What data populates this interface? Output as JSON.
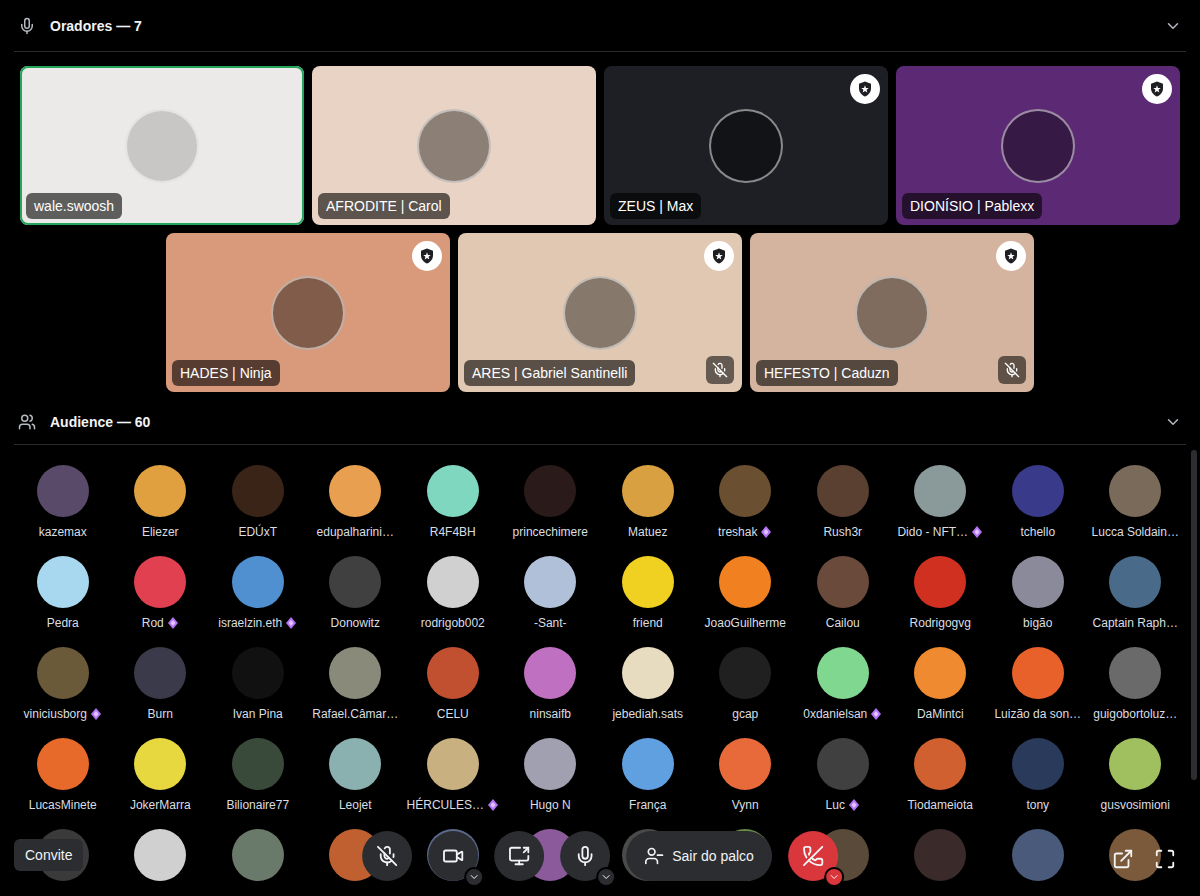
{
  "speakers": {
    "title": "Oradores — 7",
    "expanded": true,
    "items": [
      {
        "name": "wale.swoosh",
        "color": "#eceae8",
        "speaking": true,
        "moderator": false,
        "muted": false
      },
      {
        "name": "AFRODITE | Carol",
        "color": "#e8d3c4",
        "speaking": false,
        "moderator": false,
        "muted": false
      },
      {
        "name": "ZEUS | Max",
        "color": "#1d1f24",
        "speaking": false,
        "moderator": true,
        "muted": false
      },
      {
        "name": "DIONÍSIO | Pablexx",
        "color": "#5c2a74",
        "speaking": false,
        "moderator": true,
        "muted": false
      },
      {
        "name": "HADES | Ninja",
        "color": "#d99a7b",
        "speaking": false,
        "moderator": true,
        "muted": false
      },
      {
        "name": "ARES | Gabriel Santinelli",
        "color": "#e0c8b3",
        "speaking": false,
        "moderator": true,
        "muted": true
      },
      {
        "name": "HEFESTO | Caduzn",
        "color": "#d4b49e",
        "speaking": false,
        "moderator": true,
        "muted": true
      }
    ]
  },
  "audience": {
    "title": "Audience — 60",
    "expanded": true,
    "members": [
      {
        "name": "kazemax",
        "color": "#5a4a6a",
        "boosting": false
      },
      {
        "name": "Eliezer",
        "color": "#e0a040",
        "boosting": false
      },
      {
        "name": "EDÚxT",
        "color": "#3a2418",
        "boosting": false
      },
      {
        "name": "edupalharini…",
        "color": "#e8a050",
        "boosting": false
      },
      {
        "name": "R4F4BH",
        "color": "#7fd7c0",
        "boosting": false
      },
      {
        "name": "princechimere",
        "color": "#2a1a1a",
        "boosting": false
      },
      {
        "name": "Matuez",
        "color": "#d8a040",
        "boosting": false
      },
      {
        "name": "treshak",
        "color": "#6a5030",
        "boosting": true
      },
      {
        "name": "Rush3r",
        "color": "#5a4030",
        "boosting": false
      },
      {
        "name": "Dido - NFT…",
        "color": "#8a9a9a",
        "boosting": true
      },
      {
        "name": "tchello",
        "color": "#3a3a8a",
        "boosting": false
      },
      {
        "name": "Lucca Soldain…",
        "color": "#7a6a5a",
        "boosting": false
      },
      {
        "name": "Pedra",
        "color": "#a8d8f0",
        "boosting": false
      },
      {
        "name": "Rod",
        "color": "#e04050",
        "boosting": true
      },
      {
        "name": "israelzin.eth",
        "color": "#5090d0",
        "boosting": true
      },
      {
        "name": "Donowitz",
        "color": "#404040",
        "boosting": false
      },
      {
        "name": "rodrigob002",
        "color": "#d0d0d0",
        "boosting": false
      },
      {
        "name": "-Sant-",
        "color": "#b0c0d8",
        "boosting": false
      },
      {
        "name": "friend",
        "color": "#f0d020",
        "boosting": false
      },
      {
        "name": "JoaoGuilherme",
        "color": "#f08020",
        "boosting": false
      },
      {
        "name": "Cailou",
        "color": "#6a4a3a",
        "boosting": false
      },
      {
        "name": "Rodrigogvg",
        "color": "#d03020",
        "boosting": false
      },
      {
        "name": "bigão",
        "color": "#8a8a9a",
        "boosting": false
      },
      {
        "name": "Captain Raph…",
        "color": "#4a6a8a",
        "boosting": false
      },
      {
        "name": "viniciusborg",
        "color": "#6a5a3a",
        "boosting": true
      },
      {
        "name": "Burn",
        "color": "#3a3a4a",
        "boosting": false
      },
      {
        "name": "Ivan Pina",
        "color": "#111111",
        "boosting": false
      },
      {
        "name": "Rafael.Câmar…",
        "color": "#8a8a7a",
        "boosting": false
      },
      {
        "name": "CELU",
        "color": "#c05030",
        "boosting": false
      },
      {
        "name": "ninsaifb",
        "color": "#c070c0",
        "boosting": false
      },
      {
        "name": "jebediah.sats",
        "color": "#e8dcc0",
        "boosting": false
      },
      {
        "name": "gcap",
        "color": "#202020",
        "boosting": false
      },
      {
        "name": "0xdanielsan",
        "color": "#80d890",
        "boosting": true
      },
      {
        "name": "DaMintci",
        "color": "#f08a30",
        "boosting": false
      },
      {
        "name": "Luizão da son…",
        "color": "#e8602a",
        "boosting": false
      },
      {
        "name": "guigobortoluz…",
        "color": "#6a6a6a",
        "boosting": false
      },
      {
        "name": "LucasMinete",
        "color": "#e86a2a",
        "boosting": false
      },
      {
        "name": "JokerMarra",
        "color": "#e8d840",
        "boosting": false
      },
      {
        "name": "Bilionaire77",
        "color": "#3a4a3a",
        "boosting": false
      },
      {
        "name": "Leojet",
        "color": "#8ab0b0",
        "boosting": false
      },
      {
        "name": "HÉRCULES…",
        "color": "#c8b080",
        "boosting": true
      },
      {
        "name": "Hugo N",
        "color": "#a0a0b0",
        "boosting": false
      },
      {
        "name": "França",
        "color": "#60a0e0",
        "boosting": false
      },
      {
        "name": "Vynn",
        "color": "#e86a3a",
        "boosting": false
      },
      {
        "name": "Luc",
        "color": "#404040",
        "boosting": true
      },
      {
        "name": "Tiodameiota",
        "color": "#d06030",
        "boosting": false
      },
      {
        "name": "tony",
        "color": "#2a3a5a",
        "boosting": false
      },
      {
        "name": "gusvosimioni",
        "color": "#a0c060",
        "boosting": false
      }
    ],
    "partial_row": [
      {
        "color": "#3a3a3a"
      },
      {
        "color": "#d0d0d0"
      },
      {
        "color": "#6a7a6a"
      },
      {
        "color": "#c06030"
      },
      {
        "color": "#5a6a8a"
      },
      {
        "color": "#8a5a9a"
      },
      {
        "color": "#4a4a4a"
      },
      {
        "color": "#6a8a4a"
      },
      {
        "color": "#5a4a3a"
      },
      {
        "color": "#3a2a2a"
      },
      {
        "color": "#4a5a7a"
      },
      {
        "color": "#7a5a3a"
      }
    ]
  },
  "controls": {
    "invite": {
      "label": "Convite"
    },
    "buttons": [
      {
        "kind": "mute",
        "dropdown": false
      },
      {
        "kind": "camera",
        "dropdown": true
      },
      {
        "kind": "share",
        "dropdown": false
      },
      {
        "kind": "microphone",
        "dropdown": true
      },
      {
        "kind": "leave",
        "label": "Sair do palco",
        "dropdown": false
      },
      {
        "kind": "hangup",
        "dropdown": true
      }
    ],
    "view": [
      {
        "kind": "popout"
      },
      {
        "kind": "fullscreen"
      }
    ]
  }
}
